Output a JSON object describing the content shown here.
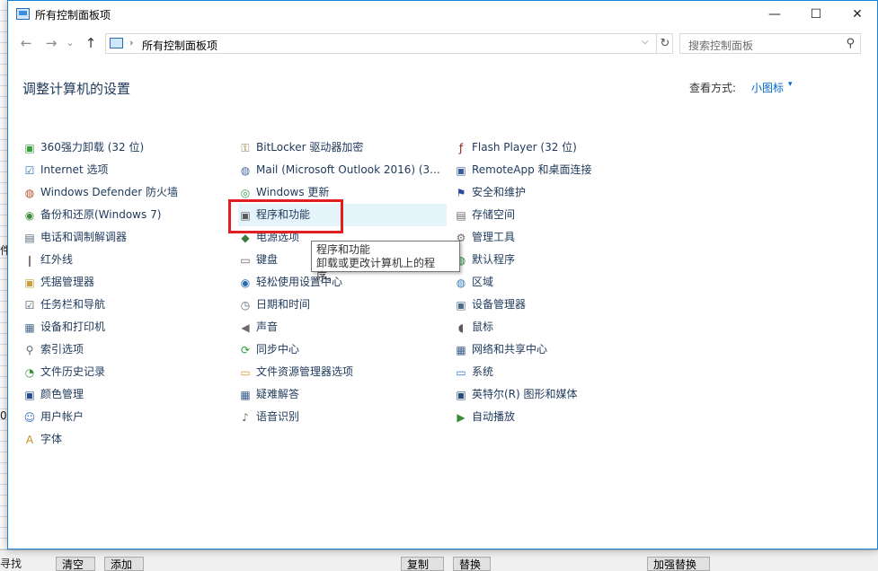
{
  "window": {
    "title": "所有控制面板项",
    "minimize": "—",
    "maximize": "☐",
    "close": "✕"
  },
  "nav": {
    "back": "←",
    "forward": "→",
    "dropdown": "⌄",
    "up": "↑",
    "breadcrumb_sep": "›",
    "address": "所有控制面板项",
    "address_dropdown": "⌵",
    "refresh": "↻",
    "search_placeholder": "搜索控制面板",
    "search_icon": "⚲"
  },
  "header": {
    "title": "调整计算机的设置",
    "view_by_label": "查看方式:",
    "view_by_value": "小图标",
    "view_by_caret": "▾"
  },
  "columns": [
    [
      {
        "label": "360强力卸载 (32 位)",
        "icon": "uninstall-icon",
        "glyph": "▣",
        "color": "#3aa040"
      },
      {
        "label": "Internet 选项",
        "icon": "internet-options-icon",
        "glyph": "☑",
        "color": "#2f74c0"
      },
      {
        "label": "Windows Defender 防火墙",
        "icon": "firewall-icon",
        "glyph": "◍",
        "color": "#b0522a"
      },
      {
        "label": "备份和还原(Windows 7)",
        "icon": "backup-icon",
        "glyph": "◉",
        "color": "#3c8a3c"
      },
      {
        "label": "电话和调制解调器",
        "icon": "phone-modem-icon",
        "glyph": "▤",
        "color": "#5a6a7a"
      },
      {
        "label": "红外线",
        "icon": "infrared-icon",
        "glyph": "❙",
        "color": "#7a7a7a"
      },
      {
        "label": "凭据管理器",
        "icon": "credential-icon",
        "glyph": "▣",
        "color": "#c8a040"
      },
      {
        "label": "任务栏和导航",
        "icon": "taskbar-icon",
        "glyph": "☑",
        "color": "#4a5a6a"
      },
      {
        "label": "设备和打印机",
        "icon": "printer-icon",
        "glyph": "▦",
        "color": "#4a6a8a"
      },
      {
        "label": "索引选项",
        "icon": "index-icon",
        "glyph": "⚲",
        "color": "#5a6a7a"
      },
      {
        "label": "文件历史记录",
        "icon": "file-history-icon",
        "glyph": "◔",
        "color": "#3a8a3a"
      },
      {
        "label": "颜色管理",
        "icon": "color-management-icon",
        "glyph": "▣",
        "color": "#2a4a8a"
      },
      {
        "label": "用户帐户",
        "icon": "user-accounts-icon",
        "glyph": "☺",
        "color": "#3a6ab0"
      },
      {
        "label": "字体",
        "icon": "fonts-icon",
        "glyph": "A",
        "color": "#c89020"
      }
    ],
    [
      {
        "label": "BitLocker 驱动器加密",
        "icon": "bitlocker-icon",
        "glyph": "⚿",
        "color": "#8a7a40"
      },
      {
        "label": "Mail (Microsoft Outlook 2016) (3...",
        "icon": "mail-icon",
        "glyph": "◍",
        "color": "#4a6a9a"
      },
      {
        "label": "Windows 更新",
        "icon": "windows-update-icon",
        "glyph": "◎",
        "color": "#3a9a4a"
      },
      {
        "label": "程序和功能",
        "icon": "programs-features-icon",
        "glyph": "▣",
        "color": "#5a5a5a"
      },
      {
        "label": "电源选项",
        "icon": "power-options-icon",
        "glyph": "◆",
        "color": "#3a7a3a"
      },
      {
        "label": "键盘",
        "icon": "keyboard-icon",
        "glyph": "▭",
        "color": "#6a6a6a"
      },
      {
        "label": "轻松使用设置中心",
        "icon": "ease-of-access-icon",
        "glyph": "◉",
        "color": "#2a6ab0"
      },
      {
        "label": "日期和时间",
        "icon": "date-time-icon",
        "glyph": "◷",
        "color": "#5a6a7a"
      },
      {
        "label": "声音",
        "icon": "sound-icon",
        "glyph": "◀",
        "color": "#6a6a6a"
      },
      {
        "label": "同步中心",
        "icon": "sync-center-icon",
        "glyph": "⟳",
        "color": "#2a9a3a"
      },
      {
        "label": "文件资源管理器选项",
        "icon": "folder-options-icon",
        "glyph": "▭",
        "color": "#d0a020"
      },
      {
        "label": "疑难解答",
        "icon": "troubleshooting-icon",
        "glyph": "▦",
        "color": "#3a5a8a"
      },
      {
        "label": "语音识别",
        "icon": "speech-recognition-icon",
        "glyph": "♪",
        "color": "#6a6a6a"
      }
    ],
    [
      {
        "label": "Flash Player (32 位)",
        "icon": "flash-player-icon",
        "glyph": "ƒ",
        "color": "#8a1a1a"
      },
      {
        "label": "RemoteApp 和桌面连接",
        "icon": "remoteapp-icon",
        "glyph": "▣",
        "color": "#3a5a9a"
      },
      {
        "label": "安全和维护",
        "icon": "security-maintenance-icon",
        "glyph": "⚑",
        "color": "#2a4aa0"
      },
      {
        "label": "存储空间",
        "icon": "storage-spaces-icon",
        "glyph": "▤",
        "color": "#6a6a6a"
      },
      {
        "label": "管理工具",
        "icon": "admin-tools-icon",
        "glyph": "⚙",
        "color": "#6a6a6a"
      },
      {
        "label": "默认程序",
        "icon": "default-programs-icon",
        "glyph": "◍",
        "color": "#2a8a3a"
      },
      {
        "label": "区域",
        "icon": "region-icon",
        "glyph": "◍",
        "color": "#3a7ab0"
      },
      {
        "label": "设备管理器",
        "icon": "device-manager-icon",
        "glyph": "▣",
        "color": "#4a6a8a"
      },
      {
        "label": "鼠标",
        "icon": "mouse-icon",
        "glyph": "◖",
        "color": "#5a5a5a"
      },
      {
        "label": "网络和共享中心",
        "icon": "network-sharing-icon",
        "glyph": "▦",
        "color": "#3a5a8a"
      },
      {
        "label": "系统",
        "icon": "system-icon",
        "glyph": "▭",
        "color": "#2a7ad0"
      },
      {
        "label": "英特尔(R) 图形和媒体",
        "icon": "intel-graphics-icon",
        "glyph": "▣",
        "color": "#2a4a7a"
      },
      {
        "label": "自动播放",
        "icon": "autoplay-icon",
        "glyph": "▶",
        "color": "#3a8a3a"
      }
    ]
  ],
  "tooltip": {
    "title": "程序和功能",
    "description": "卸载或更改计算机上的程序。"
  },
  "background_app": {
    "buttons": [
      "清空",
      "添加",
      "复制",
      "替换",
      "加强替换"
    ],
    "edge_text": [
      "件",
      "0",
      "寻找"
    ]
  }
}
